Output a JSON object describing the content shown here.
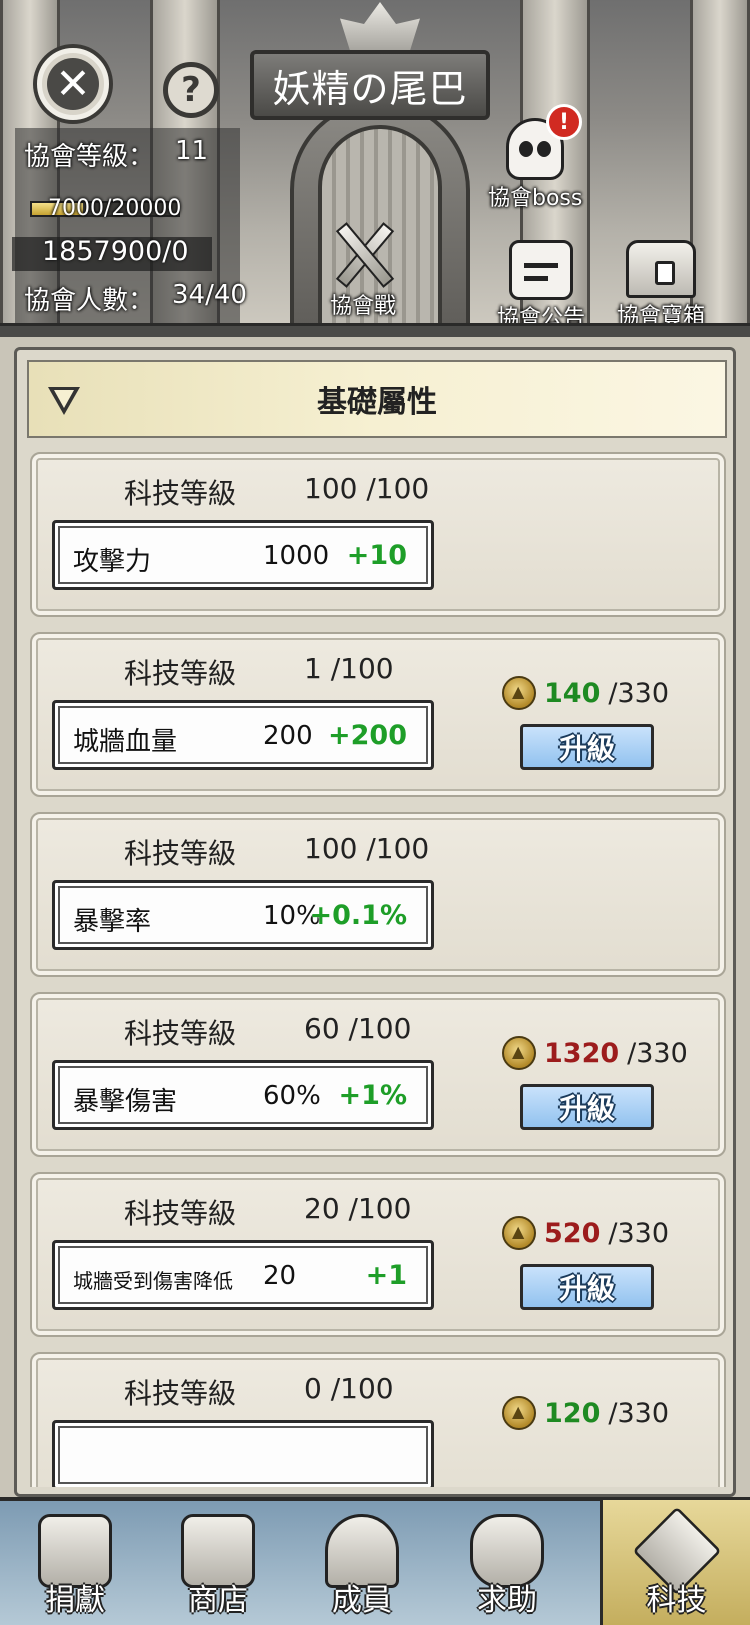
{
  "guild": {
    "name": "妖精の尾巴",
    "level_label": "協會等級：",
    "level_value": "11",
    "exp_text": "7000/20000",
    "exp_fraction": 0.35,
    "funds_text": "1857900/0",
    "members_label": "協會人數：",
    "members_value": "34/40"
  },
  "header_icons": {
    "boss_label": "協會boss",
    "alert_badge": "!",
    "war_label": "協會戰",
    "notice_label": "協會公告",
    "chest_label": "協會寶箱",
    "close_glyph": "✕",
    "help_glyph": "?"
  },
  "section": {
    "title": "基礎屬性"
  },
  "tech_cards": [
    {
      "level_label": "科技等級",
      "level": "100 /100",
      "stat_name": "攻擊力",
      "stat_value": "1000",
      "bonus": "+10"
    },
    {
      "level_label": "科技等級",
      "level": "1 /100",
      "stat_name": "城牆血量",
      "stat_value": "200",
      "bonus": "+200",
      "cost_have": "140",
      "cost_need": "/330",
      "cost_color": "#1e8a22",
      "button_label": "升級"
    },
    {
      "level_label": "科技等級",
      "level": "100 /100",
      "stat_name": "暴擊率",
      "stat_value": "10%",
      "bonus": "+0.1%"
    },
    {
      "level_label": "科技等級",
      "level": "60 /100",
      "stat_name": "暴擊傷害",
      "stat_value": "60%",
      "bonus": "+1%",
      "cost_have": "1320",
      "cost_need": "/330",
      "cost_color": "#9c1c1c",
      "button_label": "升級"
    },
    {
      "level_label": "科技等級",
      "level": "20 /100",
      "stat_name": "城牆受到傷害降低",
      "stat_value": "20",
      "bonus": "+1",
      "cost_have": "520",
      "cost_need": "/330",
      "cost_color": "#9c1c1c",
      "button_label": "升級"
    },
    {
      "level_label": "科技等級",
      "level": "0 /100",
      "cost_have": "120",
      "cost_need": "/330",
      "cost_color": "#1e8a22"
    }
  ],
  "bottom_nav": [
    {
      "label": "捐獻",
      "icon": "donate-icon"
    },
    {
      "label": "商店",
      "icon": "shop-icon"
    },
    {
      "label": "成員",
      "icon": "members-icon"
    },
    {
      "label": "求助",
      "icon": "help-request-icon"
    },
    {
      "label": "科技",
      "icon": "tech-icon",
      "active": true
    }
  ]
}
